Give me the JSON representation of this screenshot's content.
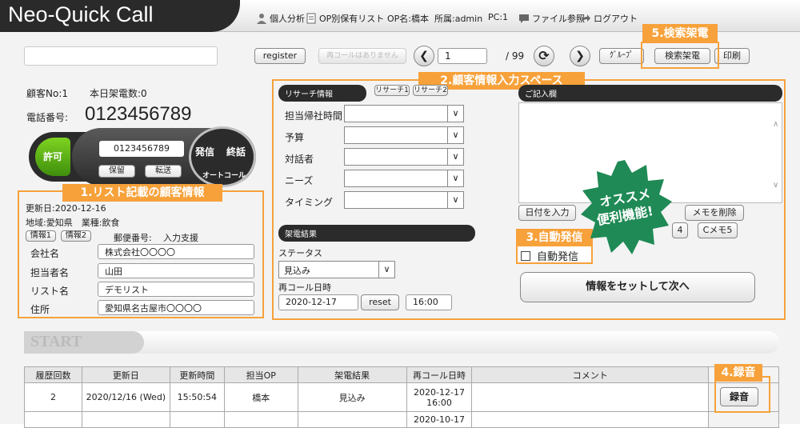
{
  "header": {
    "logo": "Neo-Quick Call",
    "personal_analysis": "個人分析",
    "op_list": "OP別保有リスト",
    "op_name": "OP名:橋本",
    "affiliation": "所属:admin",
    "pc": "PC:1",
    "file_ref": "ファイル参照",
    "logout": "ログアウト"
  },
  "toolbar": {
    "register": "register",
    "recall_none": "再コールはありません",
    "page_input": "1",
    "page_total": "/ 99",
    "group": "ｸﾞﾙｰﾌﾟ",
    "search_call": "検索架電",
    "print": "印刷"
  },
  "customer": {
    "no_label": "顧客No:1",
    "today_calls": "本日架電数:0",
    "phone_label": "電話番号:",
    "phone_number": "0123456789",
    "allow": "許可",
    "dial_input": "0123456789",
    "hold": "保留",
    "transfer": "転送",
    "call": "発信",
    "end": "終話",
    "auto_call": "オートコール"
  },
  "list_info": {
    "updated": "更新日:2020-12-16",
    "region_industry": "地域:愛知県　業種:飲食",
    "info1": "情報1",
    "info2": "情報2",
    "postal": "郵便番号:",
    "input_support": "入力支援",
    "fields": [
      {
        "label": "会社名",
        "value": "株式会社〇〇〇〇"
      },
      {
        "label": "担当者名",
        "value": "山田"
      },
      {
        "label": "リスト名",
        "value": "デモリスト"
      },
      {
        "label": "住所",
        "value": "愛知県名古屋市〇〇〇〇"
      }
    ]
  },
  "research": {
    "title": "リサーチ情報",
    "tab1": "リサーチ1",
    "tab2": "リサーチ2",
    "rows": [
      "担当帰社時間",
      "予算",
      "対話者",
      "ニーズ",
      "タイミング"
    ]
  },
  "call_result": {
    "title": "架電結果",
    "status_label": "ステータス",
    "status_value": "見込み",
    "recall_label": "再コール日時",
    "recall_date": "2020-12-17",
    "reset": "reset",
    "recall_time": "16:00"
  },
  "memo": {
    "title": "ご記入欄",
    "date_input": "日付を入力",
    "delete_memo": "メモを削除",
    "memo4": "4",
    "memo5": "Cメモ5",
    "auto_dial_label": "自動発信",
    "set_next": "情報をセットして次へ"
  },
  "badge": {
    "line1": "オススメ",
    "line2": "便利機能!"
  },
  "callouts": {
    "list_info": "1.リスト記載の顧客情報",
    "customer_input": "2.顧客情報入力スペース",
    "auto_dial": "3.自動発信",
    "record": "4.録音",
    "search_call": "5.検索架電"
  },
  "start_label": "START",
  "history": {
    "headers": [
      "履歴回数",
      "更新日",
      "更新時間",
      "担当OP",
      "架電結果",
      "再コール日時",
      "コメント"
    ],
    "rows": [
      {
        "count": "2",
        "date": "2020/12/16 (Wed)",
        "time": "15:50:54",
        "op": "橋本",
        "result": "見込み",
        "recall1": "2020-12-17",
        "recall2": "16:00",
        "comment": ""
      },
      {
        "count": "",
        "date": "",
        "time": "",
        "op": "",
        "result": "",
        "recall1": "2020-10-17",
        "recall2": "",
        "comment": ""
      }
    ],
    "record_button": "録音"
  },
  "colors": {
    "accent": "#f7a13a",
    "badge": "#1f8a55",
    "dark": "#2b2b2b"
  }
}
